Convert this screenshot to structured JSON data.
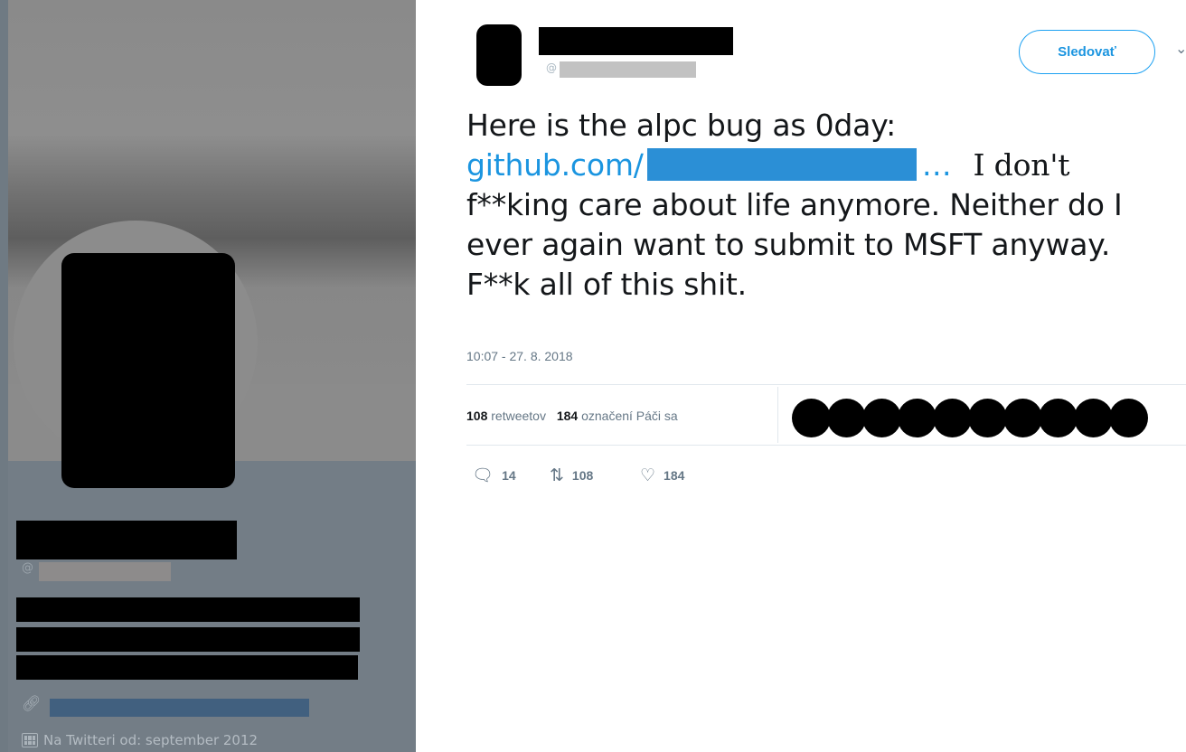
{
  "profile": {
    "at_symbol": "@",
    "joined_text": "Na Twitteri od: september 2012",
    "icons": {
      "link": "link-icon",
      "joined": "calendar-icon"
    }
  },
  "tweet": {
    "handle_at": "@",
    "follow_label": "Sledovať",
    "text_line1": "Here is the alpc bug as 0day:",
    "link_text": "github.com/",
    "link_ellipsis": "…",
    "text_after_link": "I don't",
    "text_line3": "f**king care about life anymore. Neither do I",
    "text_line4": "ever again want to submit to MSFT anyway.",
    "text_line5": "F**k all of this shit.",
    "timestamp": "10:07 - 27. 8. 2018",
    "retweets_count": "108",
    "retweets_label": "retweetov",
    "likes_count": "184",
    "likes_label": "označení Páči sa",
    "likers_shown": 10,
    "actions": {
      "reply_count": "14",
      "retweet_count": "108",
      "like_count": "184"
    },
    "colors": {
      "accent": "#1da1f2",
      "link": "#1b95e0",
      "muted": "#657786"
    }
  }
}
